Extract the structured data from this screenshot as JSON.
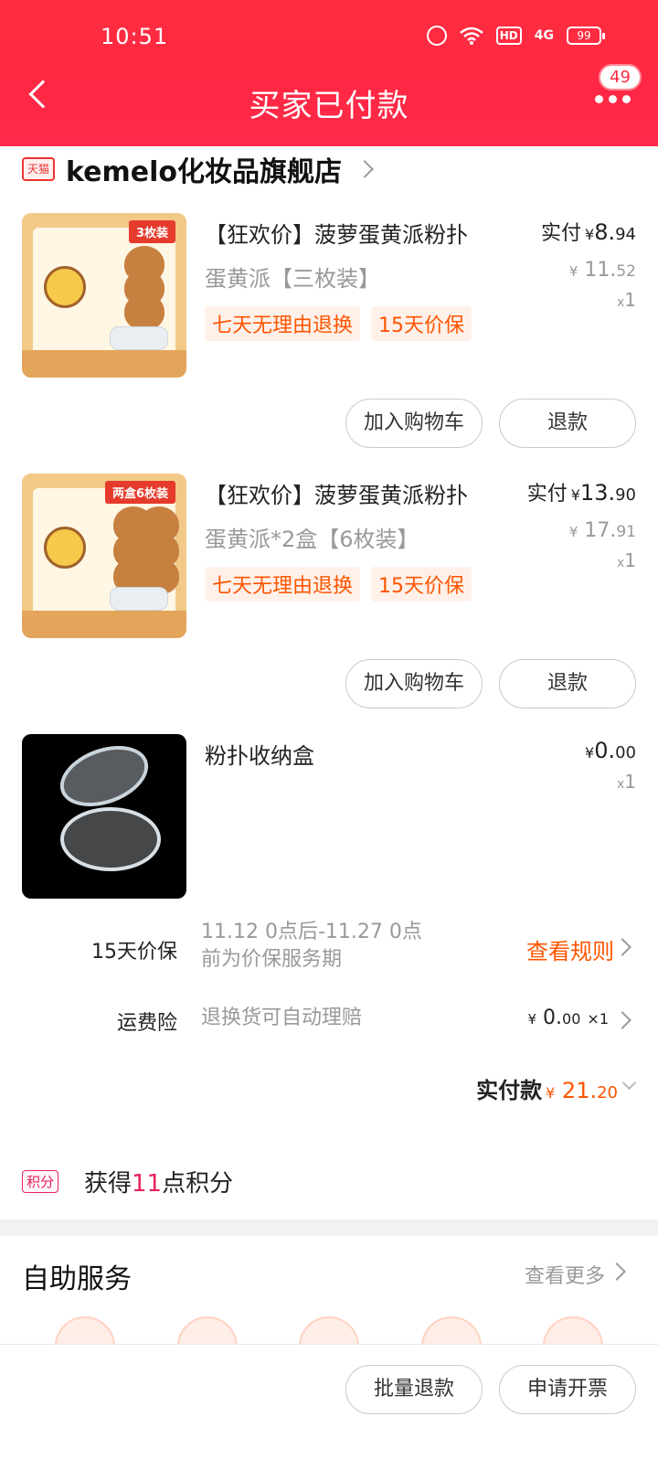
{
  "status_bar": {
    "time": "10:51",
    "hd": "HD",
    "network": "4G",
    "battery": "99"
  },
  "header": {
    "title": "买家已付款",
    "badge_count": "49"
  },
  "shop": {
    "platform_tag": "天猫",
    "name": "kemelo化妆品旗舰店"
  },
  "items": [
    {
      "title": "【狂欢价】菠萝蛋黄派粉扑",
      "sku": "蛋黄派【三枚装】",
      "image_tag": "3枚装",
      "tags": [
        "七天无理由退换",
        "15天价保"
      ],
      "paid_label": "实付",
      "currency": "¥",
      "paid_int": "8.",
      "paid_dec": "94",
      "orig_int": "11.",
      "orig_dec": "52",
      "qty_x": "x",
      "qty": "1",
      "btn_cart": "加入购物车",
      "btn_refund": "退款"
    },
    {
      "title": "【狂欢价】菠萝蛋黄派粉扑",
      "sku": "蛋黄派*2盒【6枚装】",
      "image_tag": "两盒6枚装",
      "tags": [
        "七天无理由退换",
        "15天价保"
      ],
      "paid_label": "实付",
      "currency": "¥",
      "paid_int": "13.",
      "paid_dec": "90",
      "orig_int": "17.",
      "orig_dec": "91",
      "qty_x": "x",
      "qty": "1",
      "btn_cart": "加入购物车",
      "btn_refund": "退款"
    },
    {
      "title": "粉扑收纳盒",
      "currency": "¥",
      "paid_int": "0.",
      "paid_dec": "00",
      "qty_x": "x",
      "qty": "1"
    }
  ],
  "price_protect": {
    "label": "15天价保",
    "text": "11.12 0点后-11.27 0点前为价保服务期",
    "link": "查看规则"
  },
  "shipping_insurance": {
    "label": "运费险",
    "text": "退换货可自动理赔",
    "currency": "¥",
    "value_int": "0.",
    "value_dec": "00",
    "qty": "×1"
  },
  "total": {
    "label": "实付款",
    "currency": "¥",
    "value_int": "21.",
    "value_dec": "20"
  },
  "points": {
    "tag": "积分",
    "prefix": "获得",
    "value": "11",
    "suffix": "点积分"
  },
  "self_service": {
    "title": "自助服务",
    "more": "查看更多"
  },
  "bottom_bar": {
    "batch_refund": "批量退款",
    "invoice": "申请开票"
  },
  "colors": {
    "header_red": "#ff2a44",
    "accent_orange": "#ff5500",
    "points_pink": "#e8225c"
  }
}
